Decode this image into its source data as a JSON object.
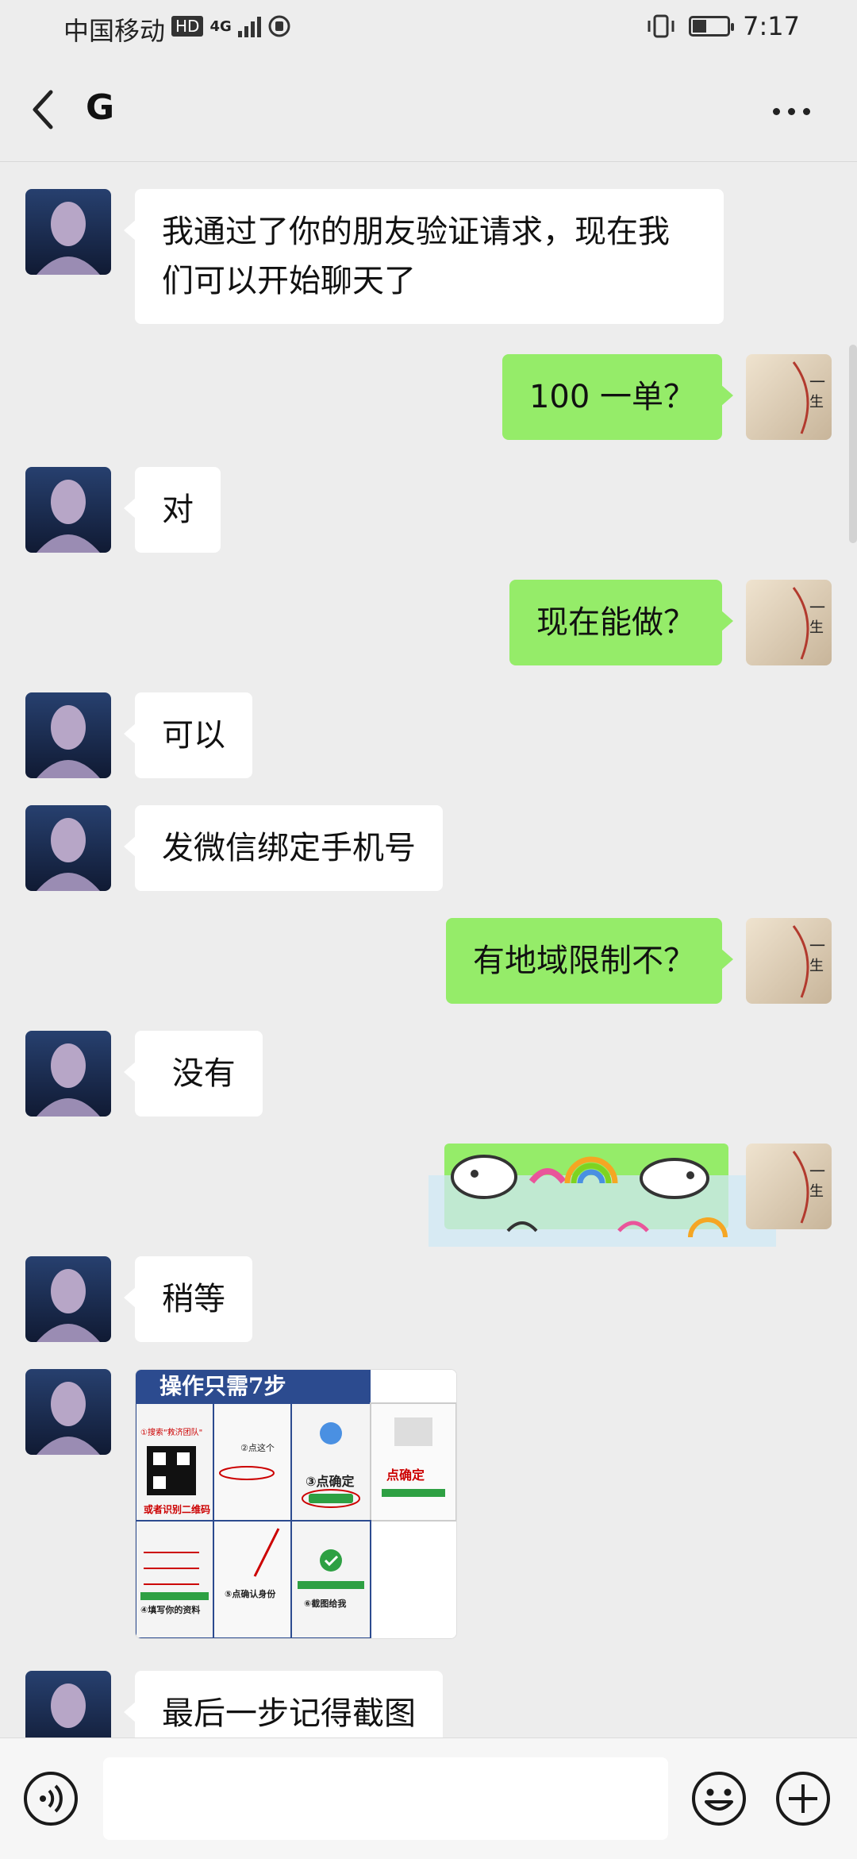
{
  "status_bar": {
    "carrier": "中国移动",
    "hd": "HD",
    "network": "4G",
    "time": "7:17",
    "battery_level": 0.4
  },
  "header": {
    "title": "G",
    "back_icon": "chevron-left-icon",
    "more_icon": "more-dots-icon"
  },
  "messages": [
    {
      "from": "other",
      "type": "text",
      "text": "我通过了你的朋友验证请求，现在我们可以开始聊天了"
    },
    {
      "from": "self",
      "type": "text",
      "text": "100 一单？"
    },
    {
      "from": "other",
      "type": "text",
      "text": "对"
    },
    {
      "from": "self",
      "type": "text",
      "text": "现在能做？"
    },
    {
      "from": "other",
      "type": "text",
      "text": "可以"
    },
    {
      "from": "other",
      "type": "text",
      "text": "发微信绑定手机号"
    },
    {
      "from": "self",
      "type": "text",
      "text": "有地域限制不？"
    },
    {
      "from": "other",
      "type": "text",
      "text": " 没有"
    },
    {
      "from": "self",
      "type": "sticker",
      "text": ""
    },
    {
      "from": "other",
      "type": "text",
      "text": "稍等"
    },
    {
      "from": "other",
      "type": "image",
      "image": {
        "banner": "操作只需7步",
        "step1": "①搜索\"救济团队\"",
        "scan": "或者识别二维码",
        "step2": "②点这个",
        "step3": "③点确定",
        "step4": "④填写你的资料",
        "step5": "⑤点确认身份",
        "step6": "⑥截图给我",
        "confirm": "点确定"
      }
    },
    {
      "from": "other",
      "type": "text",
      "text": "最后一步记得截图"
    }
  ],
  "input_bar": {
    "placeholder": "",
    "voice_icon": "voice-icon",
    "emoji_icon": "emoji-icon",
    "plus_icon": "plus-icon"
  },
  "colors": {
    "background": "#ededed",
    "self_bubble": "#95ec69",
    "other_bubble": "#ffffff"
  }
}
